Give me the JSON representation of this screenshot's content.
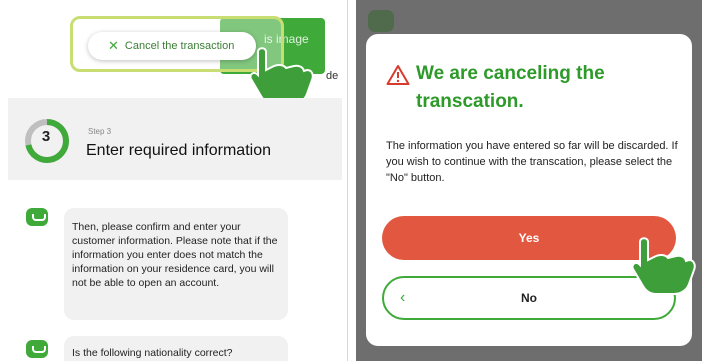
{
  "left": {
    "header": {
      "cancel_button_label": "Cancel the transaction",
      "green_tab_label": "is image",
      "green_tab_sub": "de"
    },
    "step": {
      "number": "3",
      "label": "Step 3",
      "title": "Enter required information"
    },
    "chat": {
      "message_1": "Then, please confirm and enter your customer information. Please note that if the information you enter does not match the information on your residence card, you will not be able to open an account.",
      "message_2": "Is the following nationality correct?"
    }
  },
  "right": {
    "background_text": "",
    "dialog": {
      "title": "We are canceling the transcation.",
      "body": "The information you have entered so far will be discarded. If you wish to continue with the transcation, please select the \"No\" button.",
      "yes_label": "Yes",
      "no_label": "No"
    }
  },
  "colors": {
    "brand_green": "#3faa3a",
    "title_green": "#2e9a2a",
    "danger_orange": "#e1573f",
    "highlight_yellow_green": "#c9de72",
    "warning_red": "#d83a2e"
  },
  "icons": {
    "cancel": "close-icon",
    "warning": "warning-triangle-icon",
    "chat": "chat-bubble-icon",
    "back": "chevron-left-icon",
    "pointer": "pointing-hand-icon"
  }
}
